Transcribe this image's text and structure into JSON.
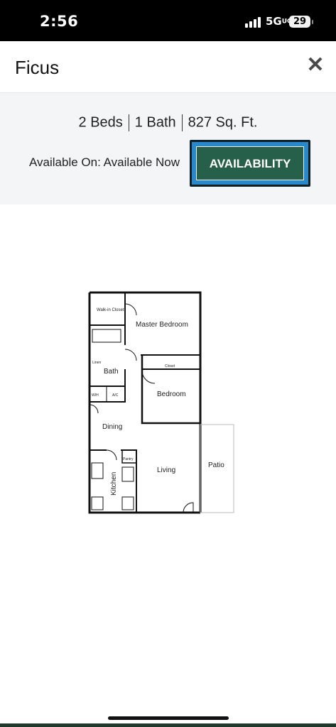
{
  "status_bar": {
    "time": "2:56",
    "network": "5G",
    "battery": "29"
  },
  "modal": {
    "title": "Ficus",
    "close_icon": "close-icon"
  },
  "unit_info": {
    "beds": "2 Beds",
    "baths": "1 Bath",
    "sqft": "827 Sq. Ft.",
    "available_text": "Available On: Available Now",
    "availability_button": "AVAILABILITY"
  },
  "floorplan": {
    "rooms": {
      "walk_in_closet": "Walk-in Closet",
      "master_bedroom": "Master Bedroom",
      "linen": "Linen",
      "closet": "Closet",
      "bath": "Bath",
      "wh": "W/H",
      "ac": "A/C",
      "bedroom": "Bedroom",
      "dining": "Dining",
      "pantry": "Pantry",
      "kitchen": "Kitchen",
      "living": "Living",
      "patio": "Patio"
    }
  },
  "colors": {
    "button_green": "#27604a",
    "button_border_blue": "#2a87c8",
    "panel_bg": "#f3f5f7"
  }
}
